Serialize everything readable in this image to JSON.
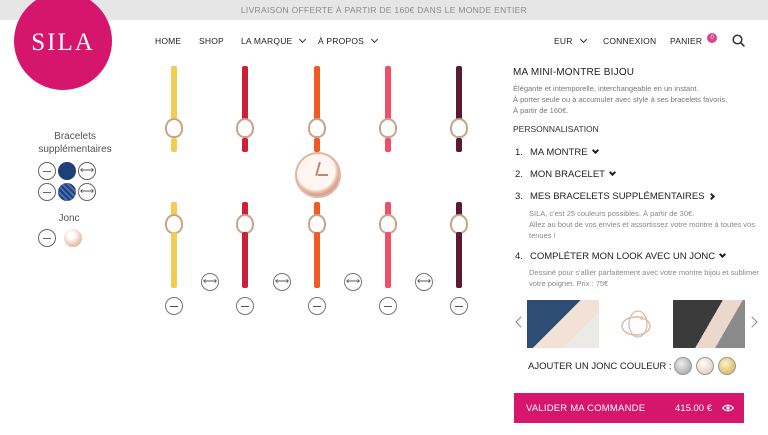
{
  "promo": "LIVRAISON OFFERTE À PARTIR DE 160€ DANS LE MONDE ENTIER",
  "logo": "SILA",
  "nav": {
    "home": "HOME",
    "shop": "SHOP",
    "marque": "LA MARQUE",
    "apropos": "À PROPOS",
    "currency": "EUR",
    "login": "CONNEXION",
    "cart": "PANIER",
    "cart_count": "0"
  },
  "sidebar": {
    "bracelets_title": "Bracelets supplémentaires",
    "jonc_title": "Jonc"
  },
  "product": {
    "title": "MA MINI-MONTRE BIJOU",
    "desc1": "Élégante et intemporelle, interchangeable en un instant.",
    "desc2": "À porter seule ou à accumuler avec style à ses bracelets favoris.",
    "desc3": "À partir de 160€.",
    "personnalisation": "PERSONNALISATION"
  },
  "steps": [
    {
      "num": "1.",
      "label": "MA MONTRE"
    },
    {
      "num": "2.",
      "label": "MON BRACELET"
    },
    {
      "num": "3.",
      "label": "MES BRACELETS SUPPLÉMENTAIRES",
      "desc1": "SILA, c'est 25 couleurs possibles. À partir de 30€.",
      "desc2": "Allez au bout de vos envies et assortissez votre montre à toutes vos tenues !"
    },
    {
      "num": "4.",
      "label": "COMPLÉTER MON LOOK AVEC UN JONC",
      "desc": "Dessiné pour s'allier parfaitement avec votre montre bijou et sublimer votre poignet. Prix : 75€"
    }
  ],
  "jonc_label": "AJOUTER UN JONC COULEUR :",
  "cta": {
    "label": "VALIDER MA COMMANDE",
    "price": "415.00 €"
  },
  "colors": {
    "brand": "#d6166c",
    "straps": [
      "#f2cc55",
      "#cc1f3a",
      "#ef5a25",
      "#f04e6b",
      "#5a1a30"
    ]
  }
}
